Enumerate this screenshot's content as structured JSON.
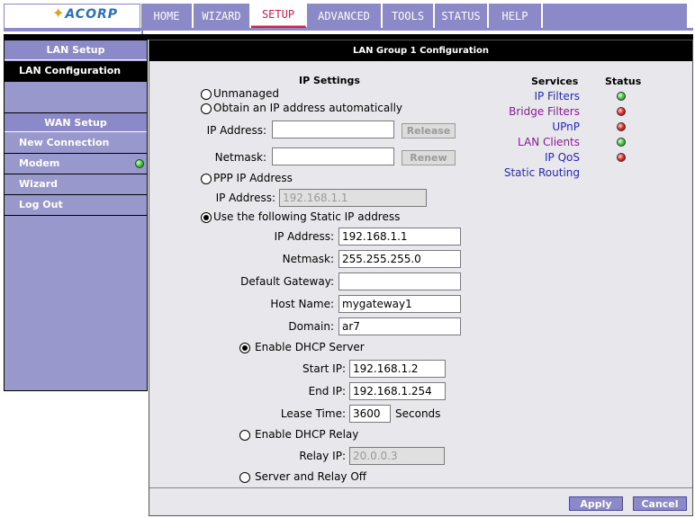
{
  "header": {
    "logo_text": "ACORP",
    "tabs": [
      {
        "label": "HOME"
      },
      {
        "label": "WIZARD"
      },
      {
        "label": "SETUP"
      },
      {
        "label": "ADVANCED"
      },
      {
        "label": "TOOLS"
      },
      {
        "label": "STATUS"
      },
      {
        "label": "HELP"
      }
    ],
    "active_tab": "SETUP"
  },
  "sidebar": {
    "lan_head": "LAN Setup",
    "lan_items": [
      {
        "label": "LAN Configuration"
      }
    ],
    "wan_head": "WAN Setup",
    "wan_items": [
      {
        "label": "New Connection"
      },
      {
        "label": "Modem"
      },
      {
        "label": "Wizard"
      },
      {
        "label": "Log Out"
      }
    ]
  },
  "main": {
    "title": "LAN Group 1 Configuration",
    "ip_settings": {
      "heading": "IP Settings",
      "unmanaged": "Unmanaged",
      "obtain_auto": "Obtain an IP address automatically",
      "auto_ip_label": "IP Address:",
      "auto_ip_value": "",
      "release": "Release",
      "auto_netmask_label": "Netmask:",
      "auto_netmask_value": "",
      "renew": "Renew",
      "ppp": "PPP IP Address",
      "ppp_ip_label": "IP Address:",
      "ppp_ip_value": "192.168.1.1",
      "static": "Use the following Static IP address",
      "static_ip_label": "IP Address:",
      "static_ip_value": "192.168.1.1",
      "static_netmask_label": "Netmask:",
      "static_netmask_value": "255.255.255.0",
      "gateway_label": "Default Gateway:",
      "gateway_value": "",
      "hostname_label": "Host Name:",
      "hostname_value": "mygateway1",
      "domain_label": "Domain:",
      "domain_value": "ar7",
      "selected": "static"
    },
    "dhcp": {
      "server": "Enable DHCP Server",
      "start_label": "Start IP:",
      "start_value": "192.168.1.2",
      "end_label": "End IP:",
      "end_value": "192.168.1.254",
      "lease_label": "Lease Time:",
      "lease_value": "3600",
      "lease_unit": "Seconds",
      "relay": "Enable DHCP Relay",
      "relay_label": "Relay IP:",
      "relay_value": "20.0.0.3",
      "off": "Server and Relay Off",
      "selected": "server"
    },
    "services": {
      "heading": "Services",
      "status_heading": "Status",
      "items": [
        {
          "label": "IP Filters",
          "color": "#2828b8",
          "status": "green"
        },
        {
          "label": "Bridge Filters",
          "color": "#8a1a9a",
          "status": "red"
        },
        {
          "label": "UPnP",
          "color": "#2828b8",
          "status": "red"
        },
        {
          "label": "LAN Clients",
          "color": "#8a1a9a",
          "status": "green"
        },
        {
          "label": "IP QoS",
          "color": "#2828b8",
          "status": "red"
        },
        {
          "label": "Static Routing",
          "color": "#2828b8",
          "status": ""
        }
      ]
    },
    "apply": "Apply",
    "cancel": "Cancel"
  },
  "colors": {
    "accent": "#8b89c8",
    "active_tab_text": "#d02050",
    "sidebar_bg": "#9898cc",
    "panel_bg": "#e8e8ec"
  }
}
